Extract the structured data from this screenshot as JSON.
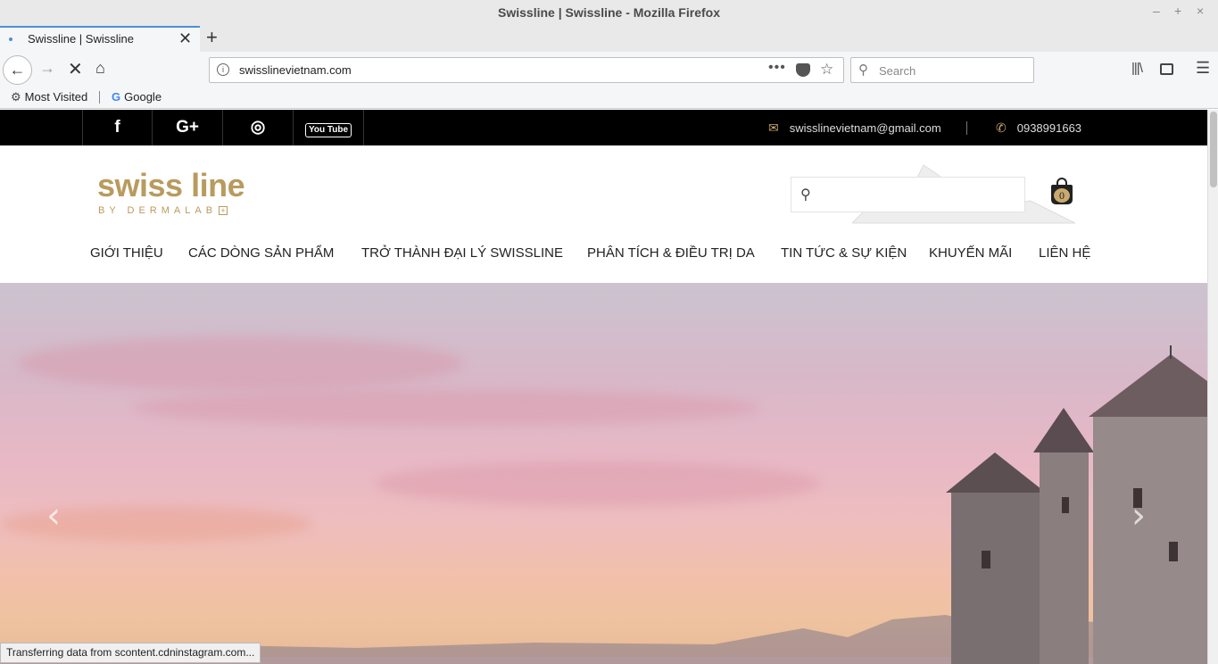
{
  "window": {
    "title": "Swissline | Swissline - Mozilla Firefox",
    "controls": [
      "–",
      "+",
      "×"
    ]
  },
  "tab": {
    "label": "Swissline | Swissline",
    "close": "✕",
    "new": "+"
  },
  "nav": {
    "url": "swisslinevietnam.com",
    "more": "•••",
    "search_placeholder": "Search"
  },
  "bookmarks": {
    "most_visited": "Most Visited",
    "google": "Google"
  },
  "site": {
    "topbar": {
      "email": "swisslinevietnam@gmail.com",
      "phone": "0938991663",
      "youtube": "You Tube",
      "gplus": "G+"
    },
    "logo": {
      "main": "swiss line",
      "sub": "BY DERMALAB"
    },
    "cart_count": "0",
    "menu": [
      {
        "label": "GIỚI THIỆU"
      },
      {
        "label": "CÁC DÒNG SẢN PHẨM"
      },
      {
        "label": "TRỞ THÀNH ĐẠI LÝ SWISSLINE"
      },
      {
        "label": "PHÂN TÍCH & ĐIỀU TRỊ DA"
      },
      {
        "label": "TIN TỨC & SỰ KIỆN"
      },
      {
        "label": "KHUYẾN MÃI"
      },
      {
        "label": "LIÊN HỆ"
      }
    ],
    "slider": {
      "prev": "‹",
      "next": "›"
    }
  },
  "status": {
    "text": "Transferring data from scontent.cdninstagram.com..."
  }
}
